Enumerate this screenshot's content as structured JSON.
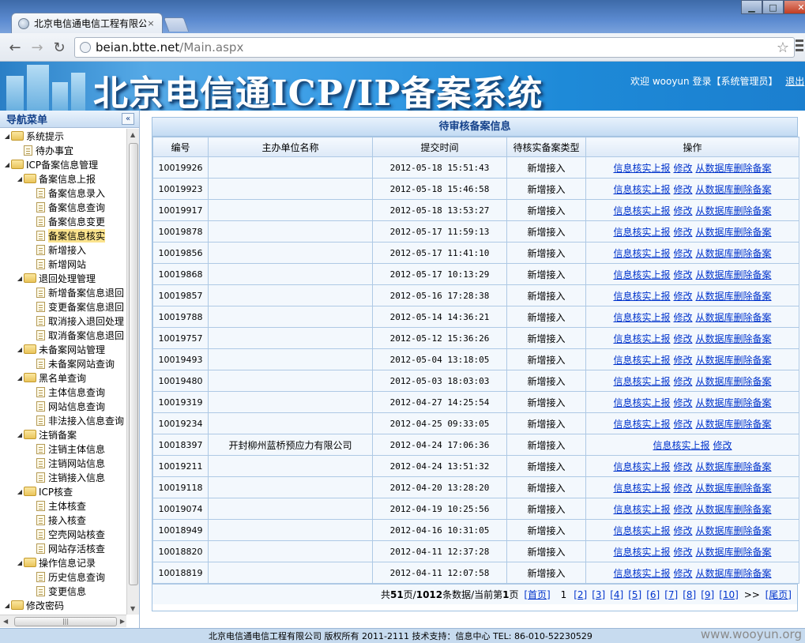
{
  "browser": {
    "tab_title": "北京电信通电信工程有限公",
    "tab_close": "×",
    "url_host": "beian.btte.net",
    "url_path": "/Main.aspx"
  },
  "banner": {
    "title": "北京电信通ICP/IP备案系统",
    "user_text": "欢迎 wooyun 登录【系统管理员】",
    "logout": "退出"
  },
  "sidebar": {
    "header": "导航菜单",
    "collapse": "«",
    "items": [
      {
        "label": "系统提示",
        "level": 0,
        "kind": "folder"
      },
      {
        "label": "待办事宜",
        "level": 1,
        "kind": "doc"
      },
      {
        "label": "ICP备案信息管理",
        "level": 0,
        "kind": "folder"
      },
      {
        "label": "备案信息上报",
        "level": 1,
        "kind": "folder"
      },
      {
        "label": "备案信息录入",
        "level": 2,
        "kind": "doc"
      },
      {
        "label": "备案信息查询",
        "level": 2,
        "kind": "doc"
      },
      {
        "label": "备案信息变更",
        "level": 2,
        "kind": "doc"
      },
      {
        "label": "备案信息核实",
        "level": 2,
        "kind": "doc",
        "selected": true
      },
      {
        "label": "新增接入",
        "level": 2,
        "kind": "doc"
      },
      {
        "label": "新增网站",
        "level": 2,
        "kind": "doc"
      },
      {
        "label": "退回处理管理",
        "level": 1,
        "kind": "folder"
      },
      {
        "label": "新增备案信息退回",
        "level": 2,
        "kind": "doc"
      },
      {
        "label": "变更备案信息退回",
        "level": 2,
        "kind": "doc"
      },
      {
        "label": "取消接入退回处理",
        "level": 2,
        "kind": "doc"
      },
      {
        "label": "取消备案信息退回",
        "level": 2,
        "kind": "doc"
      },
      {
        "label": "未备案网站管理",
        "level": 1,
        "kind": "folder"
      },
      {
        "label": "未备案网站查询",
        "level": 2,
        "kind": "doc"
      },
      {
        "label": "黑名单查询",
        "level": 1,
        "kind": "folder"
      },
      {
        "label": "主体信息查询",
        "level": 2,
        "kind": "doc"
      },
      {
        "label": "网站信息查询",
        "level": 2,
        "kind": "doc"
      },
      {
        "label": "非法接入信息查询",
        "level": 2,
        "kind": "doc"
      },
      {
        "label": "注销备案",
        "level": 1,
        "kind": "folder"
      },
      {
        "label": "注销主体信息",
        "level": 2,
        "kind": "doc"
      },
      {
        "label": "注销网站信息",
        "level": 2,
        "kind": "doc"
      },
      {
        "label": "注销接入信息",
        "level": 2,
        "kind": "doc"
      },
      {
        "label": "ICP核查",
        "level": 1,
        "kind": "folder"
      },
      {
        "label": "主体核查",
        "level": 2,
        "kind": "doc"
      },
      {
        "label": "接入核查",
        "level": 2,
        "kind": "doc"
      },
      {
        "label": "空壳网站核查",
        "level": 2,
        "kind": "doc"
      },
      {
        "label": "网站存活核查",
        "level": 2,
        "kind": "doc"
      },
      {
        "label": "操作信息记录",
        "level": 1,
        "kind": "folder"
      },
      {
        "label": "历史信息查询",
        "level": 2,
        "kind": "doc"
      },
      {
        "label": "变更信息",
        "level": 2,
        "kind": "doc"
      },
      {
        "label": "修改密码",
        "level": 0,
        "kind": "folder"
      }
    ]
  },
  "main": {
    "panel_title": "待审核备案信息",
    "columns": [
      "编号",
      "主办单位名称",
      "提交时间",
      "待核实备案类型",
      "操作"
    ],
    "actions": {
      "report": "信息核实上报",
      "edit": "修改",
      "delete": "从数据库删除备案"
    },
    "rows": [
      {
        "id": "10019926",
        "org": "",
        "time": "2012-05-18 15:51:43",
        "type": "新增接入",
        "has_delete": true
      },
      {
        "id": "10019923",
        "org": "",
        "time": "2012-05-18 15:46:58",
        "type": "新增接入",
        "has_delete": true
      },
      {
        "id": "10019917",
        "org": "",
        "time": "2012-05-18 13:53:27",
        "type": "新增接入",
        "has_delete": true
      },
      {
        "id": "10019878",
        "org": "",
        "time": "2012-05-17 11:59:13",
        "type": "新增接入",
        "has_delete": true
      },
      {
        "id": "10019856",
        "org": "",
        "time": "2012-05-17 11:41:10",
        "type": "新增接入",
        "has_delete": true
      },
      {
        "id": "10019868",
        "org": "",
        "time": "2012-05-17 10:13:29",
        "type": "新增接入",
        "has_delete": true
      },
      {
        "id": "10019857",
        "org": "",
        "time": "2012-05-16 17:28:38",
        "type": "新增接入",
        "has_delete": true
      },
      {
        "id": "10019788",
        "org": "",
        "time": "2012-05-14 14:36:21",
        "type": "新增接入",
        "has_delete": true
      },
      {
        "id": "10019757",
        "org": "",
        "time": "2012-05-12 15:36:26",
        "type": "新增接入",
        "has_delete": true
      },
      {
        "id": "10019493",
        "org": "",
        "time": "2012-05-04 13:18:05",
        "type": "新增接入",
        "has_delete": true
      },
      {
        "id": "10019480",
        "org": "",
        "time": "2012-05-03 18:03:03",
        "type": "新增接入",
        "has_delete": true
      },
      {
        "id": "10019319",
        "org": "",
        "time": "2012-04-27 14:25:54",
        "type": "新增接入",
        "has_delete": true
      },
      {
        "id": "10019234",
        "org": "",
        "time": "2012-04-25 09:33:05",
        "type": "新增接入",
        "has_delete": true
      },
      {
        "id": "10018397",
        "org": "开封柳州蓝桥预应力有限公司",
        "time": "2012-04-24 17:06:36",
        "type": "新增接入",
        "has_delete": false
      },
      {
        "id": "10019211",
        "org": "",
        "time": "2012-04-24 13:51:32",
        "type": "新增接入",
        "has_delete": true
      },
      {
        "id": "10019118",
        "org": "",
        "time": "2012-04-20 13:28:20",
        "type": "新增接入",
        "has_delete": true
      },
      {
        "id": "10019074",
        "org": "",
        "time": "2012-04-19 10:25:56",
        "type": "新增接入",
        "has_delete": true
      },
      {
        "id": "10018949",
        "org": "",
        "time": "2012-04-16 10:31:05",
        "type": "新增接入",
        "has_delete": true
      },
      {
        "id": "10018820",
        "org": "",
        "time": "2012-04-11 12:37:28",
        "type": "新增接入",
        "has_delete": true
      },
      {
        "id": "10018819",
        "org": "",
        "time": "2012-04-11 12:07:58",
        "type": "新增接入",
        "has_delete": true
      }
    ],
    "pager": {
      "summary_prefix": "共",
      "total_pages": "51",
      "mid1": "页/",
      "total_records": "1012",
      "mid2": "条数据/当前第",
      "current": "1",
      "suffix": "页",
      "first": "[首页]",
      "current_page": "1",
      "pages": [
        "[2]",
        "[3]",
        "[4]",
        "[5]",
        "[6]",
        "[7]",
        "[8]",
        "[9]",
        "[10]"
      ],
      "more": ">>",
      "last": "[尾页]"
    }
  },
  "footer": {
    "text": "北京电信通电信工程有限公司 版权所有 2011-2111 技术支持：信息中心 TEL: 86-010-52230529",
    "watermark": "www.wooyun.org"
  }
}
